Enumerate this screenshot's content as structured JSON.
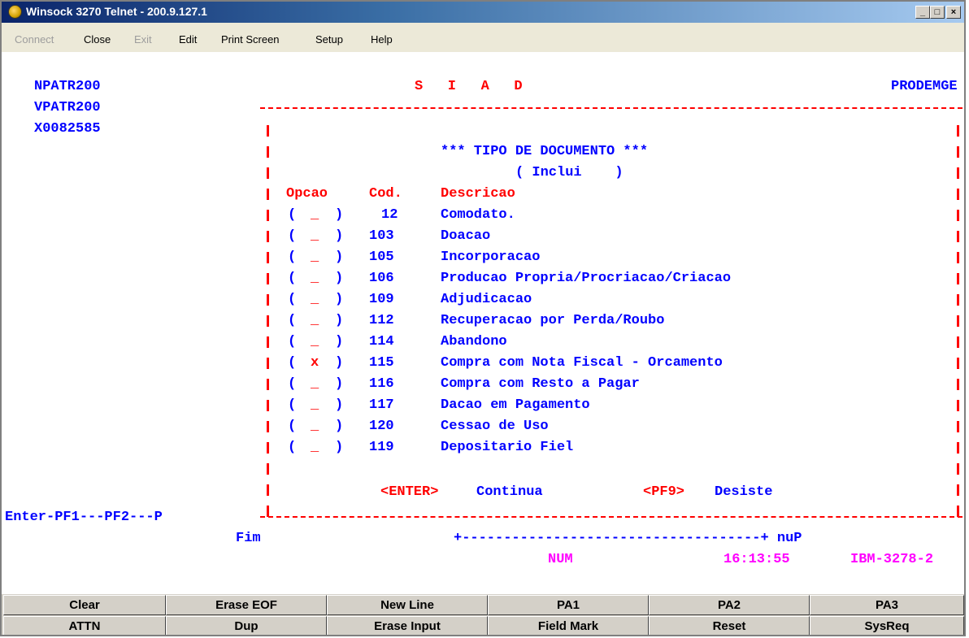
{
  "window": {
    "title": "Winsock 3270 Telnet - 200.9.127.1"
  },
  "menu": {
    "connect": "Connect",
    "close": "Close",
    "exit": "Exit",
    "edit": "Edit",
    "print_screen": "Print Screen",
    "setup": "Setup",
    "help": "Help"
  },
  "screen": {
    "program": "NPATR200",
    "view": "VPATR200",
    "user": "X0082585",
    "system": "S   I   A   D",
    "org": "PRODEMGE",
    "heading": "*** TIPO DE DOCUMENTO ***",
    "mode": "( Inclui    )",
    "col_opcao": "Opcao",
    "col_cod": "Cod.",
    "col_desc": "Descricao",
    "rows": [
      {
        "sel": "_",
        "cod": "12",
        "desc": "Comodato."
      },
      {
        "sel": "_",
        "cod": "103",
        "desc": "Doacao"
      },
      {
        "sel": "_",
        "cod": "105",
        "desc": "Incorporacao"
      },
      {
        "sel": "_",
        "cod": "106",
        "desc": "Producao Propria/Procriacao/Criacao"
      },
      {
        "sel": "_",
        "cod": "109",
        "desc": "Adjudicacao"
      },
      {
        "sel": "_",
        "cod": "112",
        "desc": "Recuperacao por Perda/Roubo"
      },
      {
        "sel": "_",
        "cod": "114",
        "desc": "Abandono"
      },
      {
        "sel": "x",
        "cod": "115",
        "desc": "Compra com Nota Fiscal - Orcamento"
      },
      {
        "sel": "_",
        "cod": "116",
        "desc": "Compra com Resto a Pagar"
      },
      {
        "sel": "_",
        "cod": "117",
        "desc": "Dacao em Pagamento"
      },
      {
        "sel": "_",
        "cod": "120",
        "desc": "Cessao de Uso"
      },
      {
        "sel": "_",
        "cod": "119",
        "desc": "Depositario Fiel"
      }
    ],
    "enter_key": "<ENTER>",
    "enter_label": "Continua",
    "pf9_key": "<PF9>",
    "pf9_label": "Desiste",
    "pf_line": "Enter-PF1---PF2---P",
    "fim": "Fim",
    "scroll_line": "+------------------------------------+ nuP",
    "status_num": "NUM",
    "status_time": "16:13:55",
    "status_term": "IBM-3278-2"
  },
  "keys": {
    "clear": "Clear",
    "erase_eof": "Erase EOF",
    "new_line": "New Line",
    "pa1": "PA1",
    "pa2": "PA2",
    "pa3": "PA3",
    "attn": "ATTN",
    "dup": "Dup",
    "erase_input": "Erase Input",
    "field_mark": "Field Mark",
    "reset": "Reset",
    "sysreq": "SysReq"
  },
  "colors": {
    "field": "#0000ff",
    "label": "#ff0000",
    "status": "#ff00ff"
  }
}
